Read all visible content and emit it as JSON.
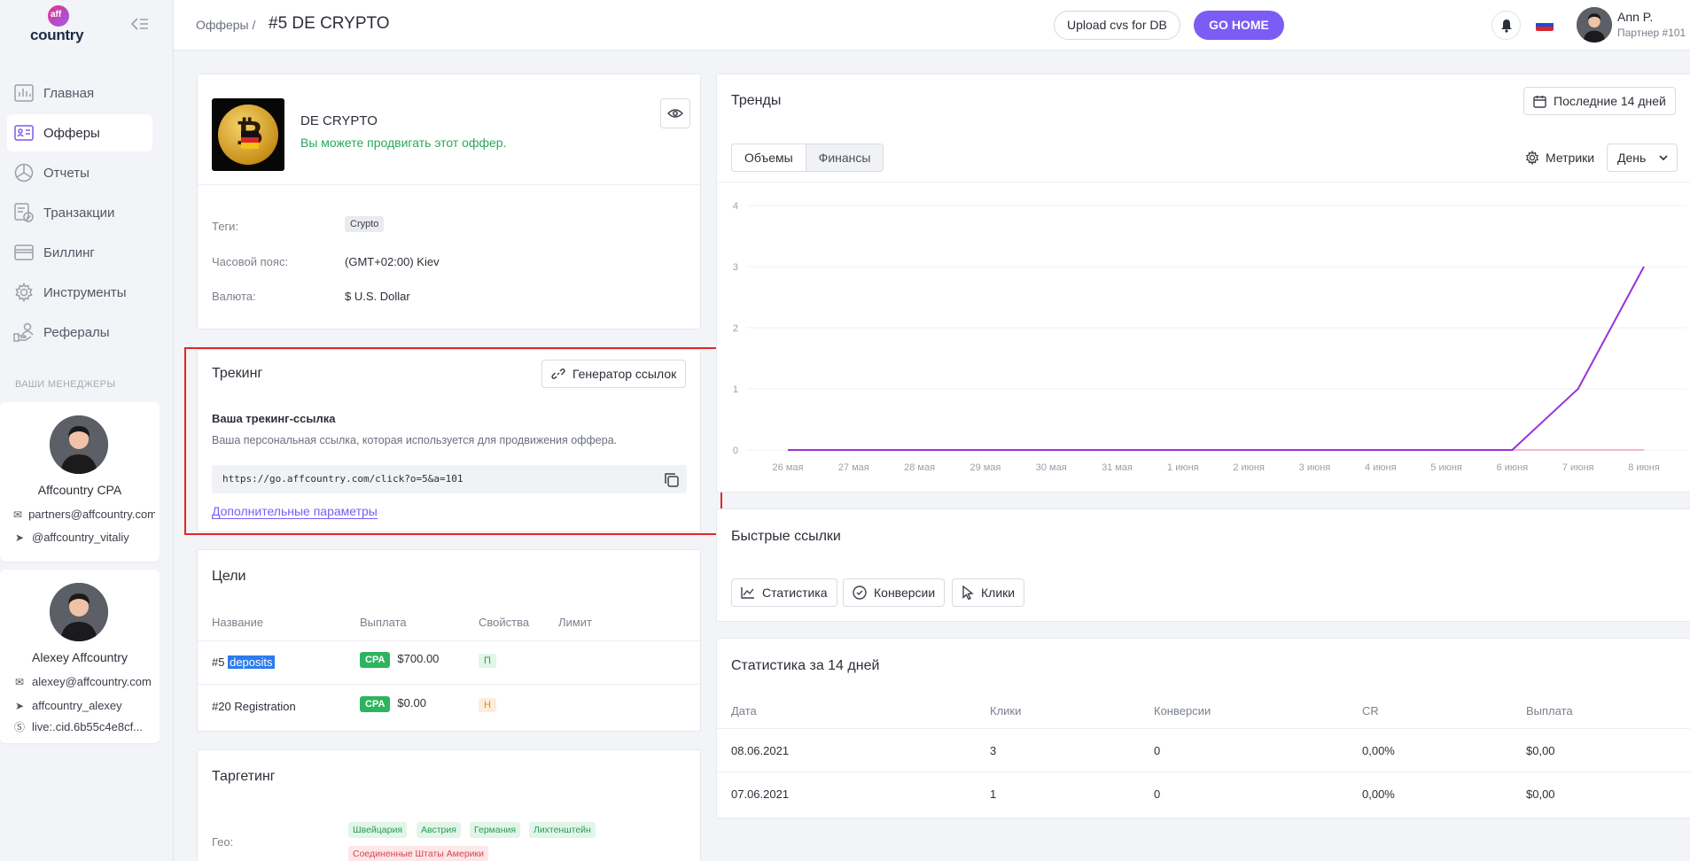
{
  "brand": {
    "logo_word": "country",
    "logo_mark": "aff"
  },
  "sidebar": {
    "items": [
      {
        "label": "Главная",
        "icon": "chart-icon"
      },
      {
        "label": "Офферы",
        "icon": "id-card-icon",
        "active": true
      },
      {
        "label": "Отчеты",
        "icon": "pie-icon"
      },
      {
        "label": "Транзакции",
        "icon": "transactions-icon"
      },
      {
        "label": "Биллинг",
        "icon": "card-icon"
      },
      {
        "label": "Инструменты",
        "icon": "gear-icon"
      },
      {
        "label": "Рефералы",
        "icon": "referrals-icon"
      }
    ],
    "managers_label": "ВАШИ МЕНЕДЖЕРЫ",
    "managers": [
      {
        "name": "Affcountry CPA",
        "email": "partners@affcountry.com",
        "telegram": "@affcountry_vitaliy"
      },
      {
        "name": "Alexey Affcountry",
        "email": "alexey@affcountry.com",
        "telegram": "affcountry_alexey",
        "skype": "live:.cid.6b55c4e8cf..."
      }
    ]
  },
  "header": {
    "breadcrumb": "Офферы /",
    "title": "#5 DE CRYPTO",
    "upload_label": "Upload cvs for DB",
    "gohome_label": "GO HOME",
    "user_name": "Ann P.",
    "user_role": "Партнер #101"
  },
  "offer": {
    "name": "DE CRYPTO",
    "promo_text": "Вы можете продвигать этот оффер.",
    "fields": {
      "tags_label": "Теги:",
      "tag": "Crypto",
      "tz_label": "Часовой пояс:",
      "tz_value": "(GMT+02:00) Kiev",
      "currency_label": "Валюта:",
      "currency_value": "$ U.S. Dollar"
    }
  },
  "tracking": {
    "title": "Трекинг",
    "generator_label": "Генератор ссылок",
    "subtitle": "Ваша трекинг-ссылка",
    "description": "Ваша персональная ссылка, которая используется для продвижения оффера.",
    "url": "https://go.affcountry.com/click?o=5&a=101",
    "more_params": "Дополнительные параметры"
  },
  "goals": {
    "title": "Цели",
    "headers": [
      "Название",
      "Выплата",
      "Свойства",
      "Лимит"
    ],
    "rows": [
      {
        "id": "#5",
        "name": "deposits",
        "type": "CPA",
        "payout": "$700.00",
        "prop": "П"
      },
      {
        "id": "#20",
        "name": "Registration",
        "type": "CPA",
        "payout": "$0.00",
        "prop": "Н"
      }
    ]
  },
  "targeting": {
    "title": "Таргетинг",
    "geo_label": "Гео:",
    "allowed": [
      "Швейцария",
      "Австрия",
      "Германия",
      "Лихтенштейн"
    ],
    "denied": [
      "Соединенные Штаты Америки"
    ]
  },
  "trends": {
    "title": "Тренды",
    "period_label": "Последние 14 дней",
    "tabs": [
      "Объемы",
      "Финансы"
    ],
    "metrics_label": "Метрики",
    "granularity": "День"
  },
  "chart_data": {
    "type": "line",
    "categories": [
      "26 мая",
      "27 мая",
      "28 мая",
      "29 мая",
      "30 мая",
      "31 мая",
      "1 июня",
      "2 июня",
      "3 июня",
      "4 июня",
      "5 июня",
      "6 июня",
      "7 июня",
      "8 июня"
    ],
    "series": [
      {
        "color": "#9b30d9",
        "values": [
          0,
          0,
          0,
          0,
          0,
          0,
          0,
          0,
          0,
          0,
          0,
          0,
          1,
          3
        ]
      },
      {
        "color": "#f0a4b4",
        "values": [
          0,
          0,
          0,
          0,
          0,
          0,
          0,
          0,
          0,
          0,
          0,
          0,
          0,
          0
        ]
      }
    ],
    "ylim": [
      0,
      4
    ],
    "yticks": [
      "0",
      "1",
      "2",
      "3",
      "4"
    ],
    "grid": true
  },
  "quick_links": {
    "title": "Быстрые ссылки",
    "items": [
      {
        "label": "Статистика",
        "icon": "line-chart-icon"
      },
      {
        "label": "Конверсии",
        "icon": "check-circle-icon"
      },
      {
        "label": "Клики",
        "icon": "cursor-icon"
      }
    ]
  },
  "stats": {
    "title": "Статистика за 14 дней",
    "headers": [
      "Дата",
      "Клики",
      "Конверсии",
      "CR",
      "Выплата"
    ],
    "rows": [
      [
        "08.06.2021",
        "3",
        "0",
        "0,00%",
        "$0,00"
      ],
      [
        "07.06.2021",
        "1",
        "0",
        "0,00%",
        "$0,00"
      ]
    ]
  },
  "colors": {
    "accent": "#7b5cf5",
    "success": "#29a85a",
    "frame": "#e0262c"
  }
}
